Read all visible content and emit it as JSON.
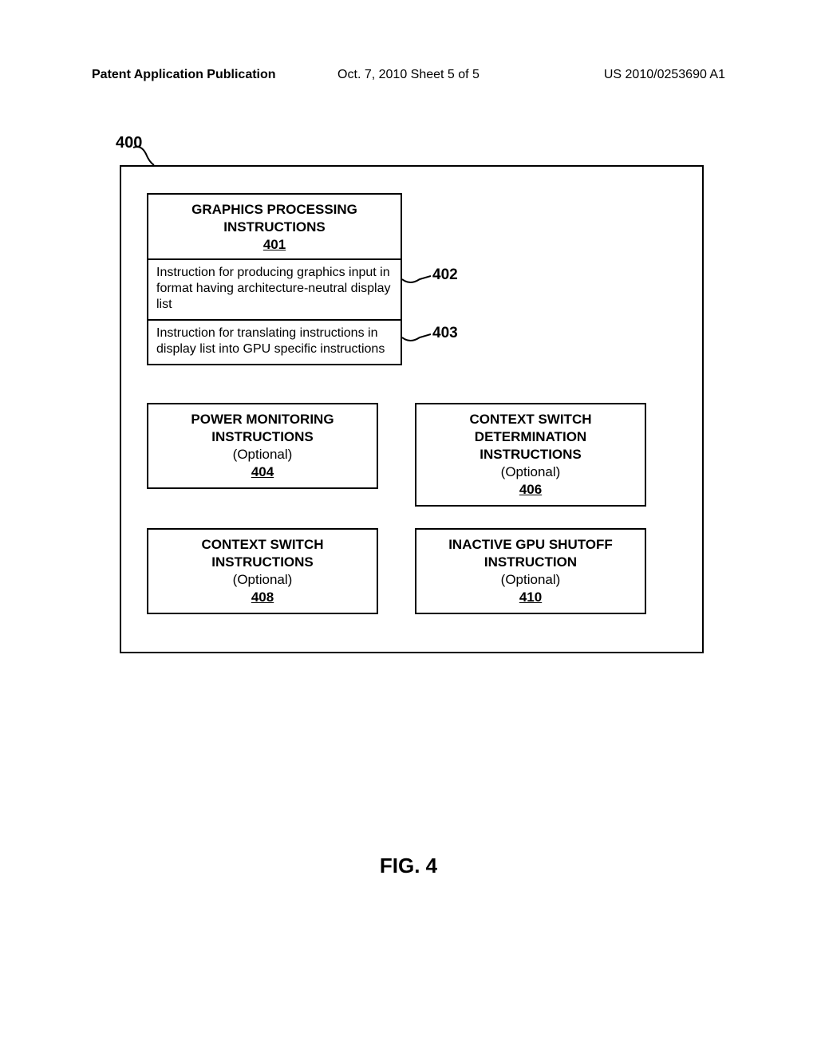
{
  "header": {
    "left": "Patent Application Publication",
    "center": "Oct. 7, 2010   Sheet 5 of 5",
    "right": "US 2010/0253690 A1"
  },
  "ref_400": "400",
  "box_401": {
    "title_line1": "GRAPHICS PROCESSING",
    "title_line2": "INSTRUCTIONS",
    "ref": "401",
    "sub1": "Instruction for producing graphics input in format having architecture-neutral display list",
    "sub2": "Instruction for translating instructions in display list into GPU specific instructions"
  },
  "callouts": {
    "c402": "402",
    "c403": "403"
  },
  "box_404": {
    "title_line1": "POWER MONITORING",
    "title_line2": "INSTRUCTIONS",
    "optional": "(Optional)",
    "ref": "404"
  },
  "box_406": {
    "title_line1": "CONTEXT SWITCH",
    "title_line2": "DETERMINATION",
    "title_line3": "INSTRUCTIONS",
    "optional": "(Optional)",
    "ref": "406"
  },
  "box_408": {
    "title_line1": "CONTEXT SWITCH",
    "title_line2": "INSTRUCTIONS",
    "optional": "(Optional)",
    "ref": "408"
  },
  "box_410": {
    "title_line1": "INACTIVE GPU SHUTOFF",
    "title_line2": "INSTRUCTION",
    "optional": "(Optional)",
    "ref": "410"
  },
  "figure_label": "FIG. 4"
}
